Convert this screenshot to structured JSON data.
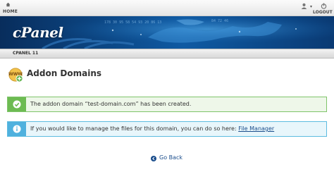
{
  "topbar": {
    "home_label": "HOME",
    "logout_label": "LOGOUT"
  },
  "banner": {
    "logo": "cPanel"
  },
  "subnav": {
    "label": "CPANEL 11"
  },
  "page": {
    "title": "Addon Domains"
  },
  "messages": {
    "success": "The addon domain “test-domain.com” has been created.",
    "info_prefix": "If you would like to manage the files for this domain, you can do so here: ",
    "info_link": "File Manager"
  },
  "actions": {
    "go_back": "Go Back"
  },
  "colors": {
    "success_accent": "#6dbb52",
    "info_accent": "#4fb1de",
    "link": "#1a4d8c",
    "banner": "#0b3e78"
  }
}
